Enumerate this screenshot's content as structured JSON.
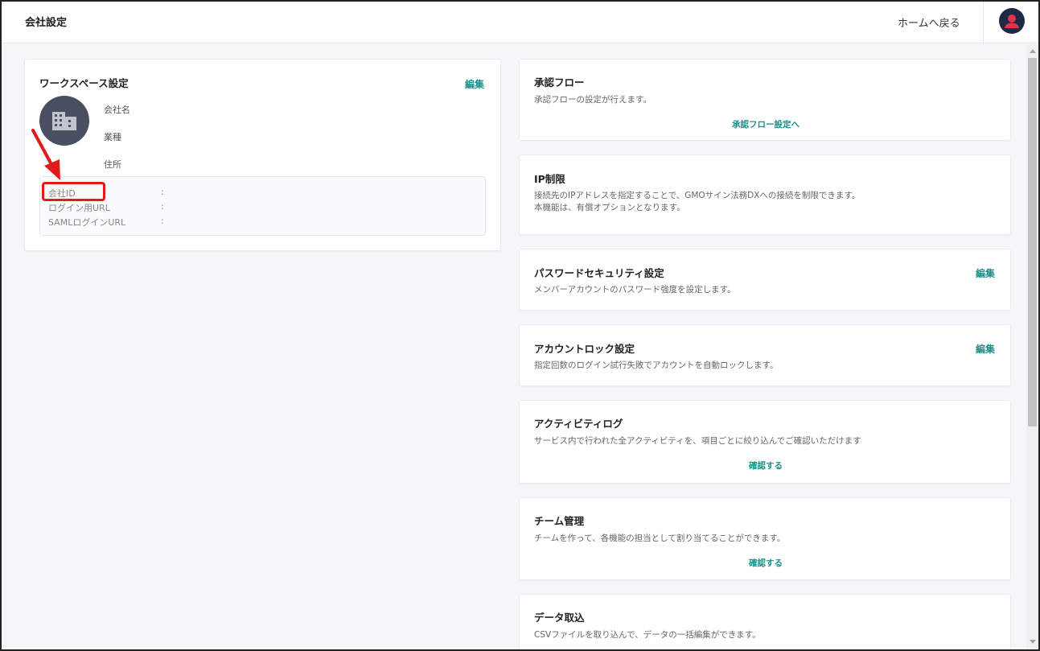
{
  "header": {
    "title": "会社設定",
    "home_link": "ホームへ戻る",
    "avatar_icon": "user-avatar-icon"
  },
  "workspace": {
    "title": "ワークスペース設定",
    "edit_label": "編集",
    "logo_icon": "building-icon",
    "fields": {
      "company_name": "会社名",
      "industry": "業種",
      "address": "住所"
    },
    "info": {
      "company_id_label": "会社ID",
      "login_url_label": "ログイン用URL",
      "saml_url_label": "SAMLログインURL",
      "separator": ":"
    }
  },
  "settings": {
    "approval_flow": {
      "title": "承認フロー",
      "description": "承認フローの設定が行えます。",
      "action": "承認フロー設定へ"
    },
    "ip_restriction": {
      "title": "IP制限",
      "description_line1": "接続先のIPアドレスを指定することで、GMOサイン法務DXへの接続を制限できます。",
      "description_line2": "本機能は、有償オプションとなります。"
    },
    "password_security": {
      "title": "パスワードセキュリティ設定",
      "description": "メンバーアカウントのパスワード強度を設定します。",
      "edit_label": "編集"
    },
    "account_lock": {
      "title": "アカウントロック設定",
      "description": "指定回数のログイン試行失敗でアカウントを自動ロックします。",
      "edit_label": "編集"
    },
    "activity_log": {
      "title": "アクティビティログ",
      "description": "サービス内で行われた全アクティビティを、項目ごとに絞り込んでご確認いただけます",
      "action": "確認する"
    },
    "team_management": {
      "title": "チーム管理",
      "description": "チームを作って、各機能の担当として割り当てることができます。",
      "action": "確認する"
    },
    "data_import": {
      "title": "データ取込",
      "description": "CSVファイルを取り込んで、データの一括編集ができます。"
    }
  },
  "colors": {
    "accent": "#1f8f8a",
    "annotation": "#e11a1a",
    "background": "#f4f6f9",
    "avatar_bg": "#1e2a44",
    "avatar_figure": "#e0334d"
  }
}
